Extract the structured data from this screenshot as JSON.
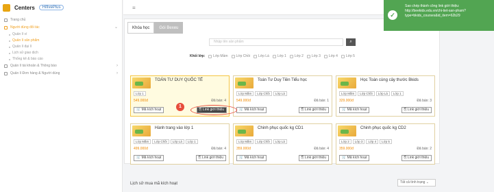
{
  "brand": {
    "name": "Centers",
    "secondary": "HifivePlus"
  },
  "sidebar": {
    "items": [
      {
        "label": "Trang chủ",
        "active": false
      },
      {
        "label": "Người dùng đối tác",
        "active": true
      },
      {
        "label": "Quản lí tài khoản & Thông báo",
        "active": false
      },
      {
        "label": "Quản lí Đơn hàng & Người dùng",
        "active": false
      }
    ],
    "subitems": [
      {
        "label": "Quản lí ví",
        "active": false
      },
      {
        "label": "Quản lí sản phẩm",
        "active": true
      },
      {
        "label": "Quản lí đại lí",
        "active": false
      },
      {
        "label": "Lịch sử giao dịch",
        "active": false
      },
      {
        "label": "Thống kê & báo cáo",
        "active": false
      }
    ]
  },
  "tabs": [
    {
      "label": "Khóa học"
    },
    {
      "label": "Gói Bexeu"
    }
  ],
  "search": {
    "placeholder": "Nhập tên sản phẩm",
    "button_icon": "search-icon"
  },
  "filters": {
    "label": "Khối lớp:",
    "options": [
      "Lớp Mầm",
      "Lớp Chồi",
      "Lớp Lá",
      "Lớp 1",
      "Lớp 2",
      "Lớp 3",
      "Lớp 4",
      "Lớp 5"
    ]
  },
  "cards": [
    {
      "title": "TOÁN TƯ DUY QUỐC TẾ",
      "tags": [
        "Lớp 1"
      ],
      "price": "549.000đ",
      "sold": "Đã bán: 4",
      "activate": "Mã kích hoạt",
      "link": "Link giới thiệu"
    },
    {
      "title": "Toán Tư Duy Tiền Tiểu học",
      "tags": [
        "Lớp Mầm",
        "Lớp Chồi",
        "Lớp Lá"
      ],
      "price": "549.000đ",
      "sold": "Đã bán: 1",
      "activate": "Mã kích hoạt",
      "link": "Link giới thiệu"
    },
    {
      "title": "Học Toán cùng cây thước Bkids",
      "tags": [
        "Lớp Mầm",
        "Lớp Chồi",
        "Lớp Lá",
        "Lớp 1"
      ],
      "price": "329.000đ",
      "sold": "Đã bán: 3",
      "activate": "Mã kích hoạt",
      "link": "Link giới thiệu"
    },
    {
      "title": "Hành trang vào lớp 1",
      "tags": [
        "Lớp Mầm",
        "Lớp Chồi",
        "Lớp Lá",
        "Lớp 1"
      ],
      "price": "499.000đ",
      "sold": "Đã bán: 4",
      "activate": "Mã kích hoạt",
      "link": "Link giới thiệu"
    },
    {
      "title": "Chinh phục quốc kg CD1",
      "tags": [
        "Lớp Mầm",
        "Lớp Chồi",
        "Lớp Lá"
      ],
      "price": "359.000đ",
      "sold": "Đã bán: 4",
      "activate": "Mã kích hoạt",
      "link": "Link giới thiệu"
    },
    {
      "title": "Chinh phục quốc kg CD2",
      "tags": [
        "Lớp 2",
        "Lớp 3",
        "Lớp 4",
        "Lớp 5"
      ],
      "price": "359.000đ",
      "sold": "Đã bán: 2",
      "activate": "Mã kích hoạt",
      "link": "Link giới thiệu"
    }
  ],
  "annotation": {
    "number": "1"
  },
  "history": {
    "title": "Lịch sử mua mã kích hoạt",
    "select": "Tất cả tình trạng"
  },
  "toast": {
    "text": "Sao chép thành công link giới thiệu: http://beekids.edu.vn/chi-tiet-san-pham?type=bkids_courses&id_item=62b29"
  },
  "colors": {
    "accent": "#f0a020",
    "toast": "#52a552",
    "badge": "#e74c3c"
  }
}
